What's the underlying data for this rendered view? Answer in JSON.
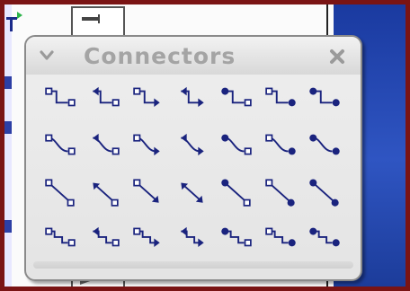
{
  "panel": {
    "title": "Connectors",
    "icons": {
      "collapse": "chevron-down-icon",
      "close": "close-icon"
    }
  },
  "connectors": {
    "rows": [
      [
        "connector-straight-plain",
        "connector-straight-arrow-start",
        "connector-straight-arrow-end",
        "connector-straight-arrows-both",
        "connector-straight-circle-start",
        "connector-straight-circle-end",
        "connector-straight-circles-both"
      ],
      [
        "connector-curved-plain",
        "connector-curved-arrow-start",
        "connector-curved-arrow-end",
        "connector-curved-arrows-both",
        "connector-curved-circle-start",
        "connector-curved-circle-end",
        "connector-curved-circles-both"
      ],
      [
        "line-connector-plain",
        "line-connector-arrow-start",
        "line-connector-arrow-end",
        "line-connector-arrows-both",
        "line-connector-circle-start",
        "line-connector-circle-end",
        "line-connector-circles-both"
      ],
      [
        "standard-connector-plain",
        "standard-connector-arrow-start",
        "standard-connector-arrow-end",
        "standard-connector-arrows-both",
        "standard-connector-circle-start",
        "standard-connector-circle-end",
        "standard-connector-circles-both"
      ]
    ]
  },
  "colors": {
    "frame": "#7a1414",
    "accent_blue": "#1a237e",
    "title_text": "#a4a4a4",
    "side_panel": "#2f55c2"
  }
}
